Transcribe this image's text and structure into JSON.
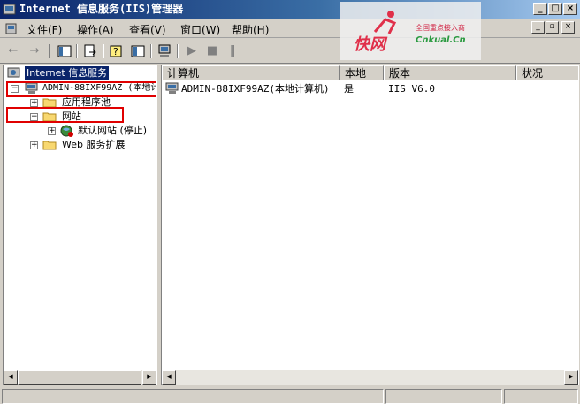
{
  "window": {
    "title": "Internet 信息服务(IIS)管理器",
    "buttons": [
      "_",
      "□",
      "×"
    ]
  },
  "menu": {
    "items": [
      "文件(F)",
      "操作(A)",
      "查看(V)",
      "窗口(W)",
      "帮助(H)"
    ],
    "mdi_buttons": [
      "_",
      "▫",
      "×"
    ]
  },
  "watermark": {
    "logo": "快网",
    "tagline": "全国重点接入商",
    "domain": "Cnkual.Cn"
  },
  "toolbar": {
    "back_icon": "back-arrow-icon",
    "forward_icon": "forward-arrow-icon",
    "play_icon": "start-icon",
    "stop_icon": "stop-icon",
    "pause_icon": "pause-icon"
  },
  "tree": {
    "root": "Internet 信息服务",
    "server": "ADMIN-88IXF99AZ (本地计",
    "app_pools": "应用程序池",
    "websites": "网站",
    "default_site": "默认网站  (停止)",
    "web_ext": "Web 服务扩展"
  },
  "list": {
    "columns": [
      "计算机",
      "本地",
      "版本",
      "状况"
    ],
    "rows": [
      {
        "computer": "ADMIN-88IXF99AZ(本地计算机)",
        "local": "是",
        "version": "IIS V6.0",
        "status": ""
      }
    ]
  },
  "colors": {
    "title_gradient_start": "#0a246a",
    "highlight": "#0a246a",
    "red_annotation": "#e00000"
  }
}
